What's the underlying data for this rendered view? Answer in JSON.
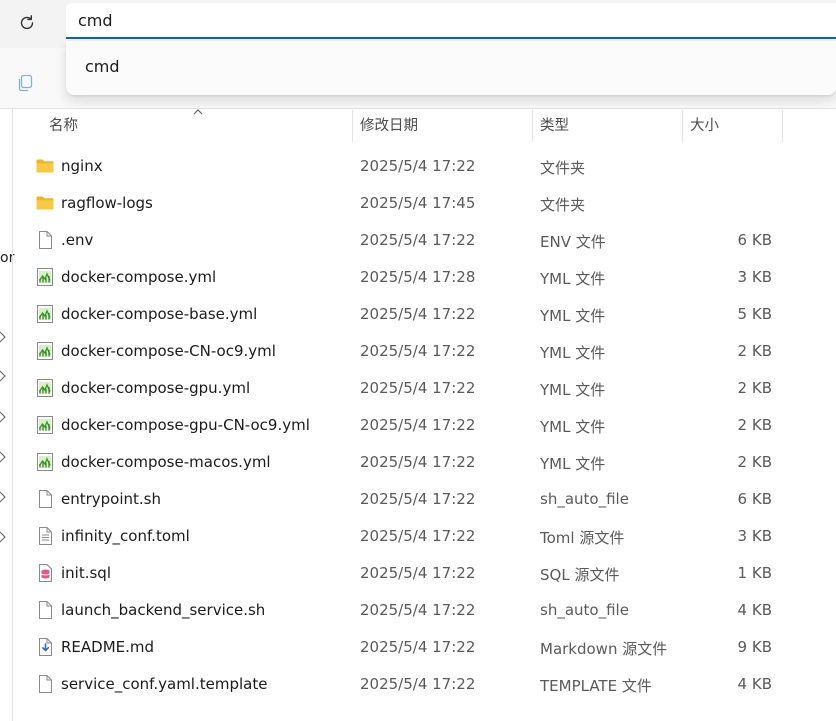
{
  "address": {
    "value": "cmd"
  },
  "suggestions": [
    "cmd"
  ],
  "nav": {
    "partial_label": "or"
  },
  "columns": {
    "name": "名称",
    "modified": "修改日期",
    "type": "类型",
    "size": "大小"
  },
  "files": [
    {
      "name": "nginx",
      "date": "2025/5/4 17:22",
      "type": "文件夹",
      "size": "",
      "icon": "folder-icon"
    },
    {
      "name": "ragflow-logs",
      "date": "2025/5/4 17:45",
      "type": "文件夹",
      "size": "",
      "icon": "folder-icon"
    },
    {
      "name": ".env",
      "date": "2025/5/4 17:22",
      "type": "ENV 文件",
      "size": "6 KB",
      "icon": "file-icon"
    },
    {
      "name": "docker-compose.yml",
      "date": "2025/5/4 17:28",
      "type": "YML 文件",
      "size": "3 KB",
      "icon": "yml-file-icon"
    },
    {
      "name": "docker-compose-base.yml",
      "date": "2025/5/4 17:22",
      "type": "YML 文件",
      "size": "5 KB",
      "icon": "yml-file-icon"
    },
    {
      "name": "docker-compose-CN-oc9.yml",
      "date": "2025/5/4 17:22",
      "type": "YML 文件",
      "size": "2 KB",
      "icon": "yml-file-icon"
    },
    {
      "name": "docker-compose-gpu.yml",
      "date": "2025/5/4 17:22",
      "type": "YML 文件",
      "size": "2 KB",
      "icon": "yml-file-icon"
    },
    {
      "name": "docker-compose-gpu-CN-oc9.yml",
      "date": "2025/5/4 17:22",
      "type": "YML 文件",
      "size": "2 KB",
      "icon": "yml-file-icon"
    },
    {
      "name": "docker-compose-macos.yml",
      "date": "2025/5/4 17:22",
      "type": "YML 文件",
      "size": "2 KB",
      "icon": "yml-file-icon"
    },
    {
      "name": "entrypoint.sh",
      "date": "2025/5/4 17:22",
      "type": "sh_auto_file",
      "size": "6 KB",
      "icon": "file-icon"
    },
    {
      "name": "infinity_conf.toml",
      "date": "2025/5/4 17:22",
      "type": "Toml 源文件",
      "size": "3 KB",
      "icon": "text-file-icon"
    },
    {
      "name": "init.sql",
      "date": "2025/5/4 17:22",
      "type": "SQL 源文件",
      "size": "1 KB",
      "icon": "sql-file-icon"
    },
    {
      "name": "launch_backend_service.sh",
      "date": "2025/5/4 17:22",
      "type": "sh_auto_file",
      "size": "4 KB",
      "icon": "file-icon"
    },
    {
      "name": "README.md",
      "date": "2025/5/4 17:22",
      "type": "Markdown 源文件",
      "size": "9 KB",
      "icon": "markdown-file-icon"
    },
    {
      "name": "service_conf.yaml.template",
      "date": "2025/5/4 17:22",
      "type": "TEMPLATE 文件",
      "size": "4 KB",
      "icon": "file-icon"
    }
  ],
  "colors": {
    "accent": "#0067c0",
    "folder": "#f8c846",
    "yml_green": "#3f9a2c"
  }
}
